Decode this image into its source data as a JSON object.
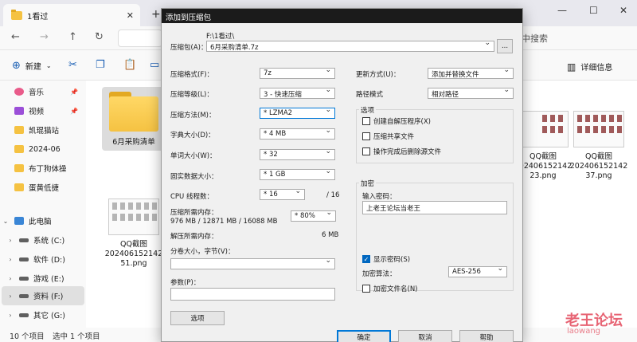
{
  "explorer": {
    "tab_title": "1看过",
    "tab_close": "✕",
    "new_tab": "+",
    "search_placeholder": "中搜索",
    "commands": {
      "new_label": "新建",
      "detail_label": "详细信息"
    },
    "sidebar": [
      {
        "label": "音乐",
        "icon": "music-icon"
      },
      {
        "label": "视频",
        "icon": "video-icon"
      },
      {
        "label": "凯琨猫站",
        "icon": "folder-icon"
      },
      {
        "label": "2024-06",
        "icon": "folder-icon"
      },
      {
        "label": "布丁狗体操",
        "icon": "folder-icon"
      },
      {
        "label": "蛋黄低捷",
        "icon": "folder-icon"
      },
      {
        "label": "此电脑",
        "icon": "pc-icon"
      },
      {
        "label": "系统 (C:)",
        "icon": "drive-icon"
      },
      {
        "label": "软件 (D:)",
        "icon": "drive-icon"
      },
      {
        "label": "游戏 (E:)",
        "icon": "drive-icon"
      },
      {
        "label": "资料 (F:)",
        "icon": "drive-icon"
      },
      {
        "label": "其它 (G:)",
        "icon": "drive-icon"
      }
    ],
    "files": [
      {
        "name": "6月采购清单"
      },
      {
        "name": "QQ截图202406152142 51.png"
      },
      {
        "name": "QQ截图202406152142 23.png"
      },
      {
        "name": "QQ截图202406152142 37.png"
      }
    ],
    "status": {
      "count": "10 个项目",
      "selected": "选中 1 个项目"
    }
  },
  "dialog": {
    "title": "添加到压缩包",
    "archive_label": "压缩包(A)：",
    "archive_path": "F:\\1看过\\",
    "archive_name": "6月采购清单.7z",
    "browse_label": "...",
    "format_label": "压缩格式(F)：",
    "format_value": "7z",
    "level_label": "压缩等级(L)：",
    "level_value": "3 - 快速压缩",
    "method_label": "压缩方法(M)：",
    "method_value": "* LZMA2",
    "dict_label": "字典大小(D)：",
    "dict_value": "* 4 MB",
    "word_label": "单词大小(W)：",
    "word_value": "* 32",
    "solid_label": "固实数据大小：",
    "solid_value": "* 1 GB",
    "threads_label": "CPU 线程数：",
    "threads_value": "* 16",
    "threads_max": "/ 16",
    "mem_comp_label": "压缩所需内存：",
    "mem_comp_value": "976 MB / 12871 MB / 16088 MB",
    "mem_comp_pct": "* 80%",
    "mem_decomp_label": "解压所需内存：",
    "mem_decomp_value": "6 MB",
    "split_label": "分卷大小，字节(V)：",
    "params_label": "参数(P)：",
    "options_button": "选项",
    "update_label": "更新方式(U)：",
    "update_value": "添加并替换文件",
    "pathmode_label": "路径模式",
    "pathmode_value": "相对路径",
    "options_group": "选项",
    "opt_sfx": "创建自解压程序(X)",
    "opt_shared": "压缩共享文件",
    "opt_delete": "操作完成后删除源文件",
    "encrypt_group": "加密",
    "password_label": "输入密码：",
    "password_value": "上老王论坛当老王",
    "show_password": "显示密码(S)",
    "enc_method_label": "加密算法：",
    "enc_method_value": "AES-256",
    "encrypt_names": "加密文件名(N)",
    "ok_button": "确定",
    "cancel_button": "取消",
    "help_button": "帮助"
  },
  "watermark": {
    "text": "老王论坛",
    "sub": "laowang"
  }
}
